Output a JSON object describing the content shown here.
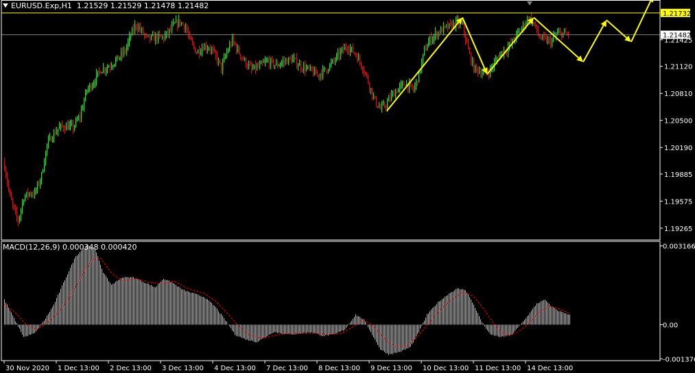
{
  "header": {
    "symbol": "EURUSD.Exp,H1",
    "ohlc": "1.21529 1.21529 1.21478 1.21482"
  },
  "macd_header": {
    "name": "MACD(12,26,9)",
    "values": "0.000348 0.000420"
  },
  "colors": {
    "bull": "#00ff00",
    "bear": "#ff0000",
    "level_line": "#ffff00",
    "arrows": "#ffff00",
    "macd_hist": "#c0c0c0",
    "signal": "#ff0000",
    "axis": "#ffffff",
    "bid_line": "#808080"
  },
  "chart_data": [
    {
      "type": "candlestick",
      "title": "EURUSD.Exp,H1",
      "ylim": [
        1.1913,
        1.2188
      ],
      "y_ticks": [
        "1.21425",
        "1.21120",
        "1.20810",
        "1.20500",
        "1.20190",
        "1.19885",
        "1.19575",
        "1.19265"
      ],
      "x_ticks": [
        "30 Nov 2020",
        "1 Dec 13:00",
        "2 Dec 13:00",
        "3 Dec 13:00",
        "4 Dec 13:00",
        "7 Dec 13:00",
        "8 Dec 13:00",
        "9 Dec 13:00",
        "10 Dec 13:00",
        "11 Dec 13:00",
        "14 Dec 13:00"
      ],
      "horizontal_line": {
        "label": "1.21732",
        "value": 1.21732
      },
      "current_price": {
        "label": "1.21482",
        "value": 1.21482
      },
      "close_anchors": [
        [
          0,
          1.1998
        ],
        [
          4,
          1.1962
        ],
        [
          8,
          1.1942
        ],
        [
          10,
          1.1935
        ],
        [
          14,
          1.1962
        ],
        [
          18,
          1.1967
        ],
        [
          22,
          1.1966
        ],
        [
          27,
          1.1987
        ],
        [
          31,
          1.2022
        ],
        [
          35,
          1.2033
        ],
        [
          40,
          1.2042
        ],
        [
          45,
          1.2043
        ],
        [
          50,
          1.2042
        ],
        [
          55,
          1.2055
        ],
        [
          60,
          1.2085
        ],
        [
          64,
          1.2092
        ],
        [
          70,
          1.2108
        ],
        [
          76,
          1.2112
        ],
        [
          82,
          1.212
        ],
        [
          88,
          1.213
        ],
        [
          92,
          1.2148
        ],
        [
          96,
          1.216
        ],
        [
          100,
          1.2152
        ],
        [
          104,
          1.2143
        ],
        [
          110,
          1.2145
        ],
        [
          116,
          1.2145
        ],
        [
          120,
          1.2152
        ],
        [
          124,
          1.216
        ],
        [
          128,
          1.2163
        ],
        [
          132,
          1.2157
        ],
        [
          135,
          1.2142
        ],
        [
          140,
          1.2128
        ],
        [
          145,
          1.2135
        ],
        [
          150,
          1.2133
        ],
        [
          155,
          1.212
        ],
        [
          158,
          1.211
        ],
        [
          162,
          1.2128
        ],
        [
          166,
          1.2142
        ],
        [
          170,
          1.213
        ],
        [
          175,
          1.2118
        ],
        [
          180,
          1.2108
        ],
        [
          186,
          1.2112
        ],
        [
          192,
          1.2118
        ],
        [
          198,
          1.2113
        ],
        [
          204,
          1.2118
        ],
        [
          210,
          1.212
        ],
        [
          216,
          1.2112
        ],
        [
          222,
          1.2108
        ],
        [
          228,
          1.2102
        ],
        [
          234,
          1.2108
        ],
        [
          240,
          1.2118
        ],
        [
          246,
          1.213
        ],
        [
          250,
          1.2135
        ],
        [
          256,
          1.2126
        ],
        [
          262,
          1.2108
        ],
        [
          266,
          1.209
        ],
        [
          270,
          1.2072
        ],
        [
          274,
          1.2063
        ],
        [
          278,
          1.2068
        ],
        [
          282,
          1.2078
        ],
        [
          286,
          1.2085
        ],
        [
          292,
          1.2093
        ],
        [
          298,
          1.2085
        ],
        [
          302,
          1.2102
        ],
        [
          306,
          1.213
        ],
        [
          310,
          1.2142
        ],
        [
          315,
          1.215
        ],
        [
          320,
          1.2155
        ],
        [
          325,
          1.2158
        ],
        [
          330,
          1.2162
        ],
        [
          334,
          1.2158
        ],
        [
          338,
          1.213
        ],
        [
          342,
          1.211
        ],
        [
          346,
          1.2107
        ],
        [
          350,
          1.2103
        ],
        [
          354,
          1.2108
        ],
        [
          358,
          1.2118
        ],
        [
          362,
          1.2128
        ],
        [
          366,
          1.2132
        ],
        [
          370,
          1.214
        ],
        [
          374,
          1.215
        ],
        [
          378,
          1.2158
        ],
        [
          382,
          1.2168
        ],
        [
          386,
          1.216
        ],
        [
          390,
          1.2145
        ],
        [
          394,
          1.2142
        ],
        [
          398,
          1.214
        ],
        [
          402,
          1.2148
        ],
        [
          406,
          1.215
        ],
        [
          411,
          1.2148
        ]
      ],
      "forecast_arrows": [
        [
          [
            279,
            1.2061
          ],
          [
            334,
            1.2168
          ]
        ],
        [
          [
            334,
            1.2168
          ],
          [
            352,
            1.2103
          ]
        ],
        [
          [
            352,
            1.2103
          ],
          [
            386,
            1.2168
          ]
        ],
        [
          [
            386,
            1.2168
          ],
          [
            422,
            1.2117
          ]
        ],
        [
          [
            422,
            1.2117
          ],
          [
            439,
            1.2165
          ]
        ],
        [
          [
            439,
            1.2165
          ],
          [
            457,
            1.214
          ]
        ],
        [
          [
            457,
            1.214
          ],
          [
            473,
            1.2193
          ]
        ]
      ]
    },
    {
      "type": "macd",
      "title": "MACD(12,26,9)",
      "ylim": [
        -0.00145,
        0.00335
      ],
      "y_ticks": [
        {
          "label": "0.003166",
          "value": 0.003166
        },
        {
          "label": "0.00",
          "value": 0
        },
        {
          "label": "-0.001376",
          "value": -0.001376
        }
      ],
      "macd_anchors": [
        [
          0,
          0.001
        ],
        [
          8,
          0.00015
        ],
        [
          14,
          -0.0005
        ],
        [
          22,
          -0.00035
        ],
        [
          30,
          0.00025
        ],
        [
          36,
          0.0008
        ],
        [
          44,
          0.0018
        ],
        [
          52,
          0.00275
        ],
        [
          60,
          0.0032
        ],
        [
          66,
          0.00305
        ],
        [
          72,
          0.0021
        ],
        [
          78,
          0.0016
        ],
        [
          86,
          0.0019
        ],
        [
          94,
          0.0019
        ],
        [
          102,
          0.0017
        ],
        [
          110,
          0.0015
        ],
        [
          116,
          0.00185
        ],
        [
          122,
          0.0017
        ],
        [
          130,
          0.0014
        ],
        [
          138,
          0.00125
        ],
        [
          146,
          0.0011
        ],
        [
          154,
          0.0007
        ],
        [
          162,
          0.0001
        ],
        [
          168,
          -0.0004
        ],
        [
          176,
          -0.0006
        ],
        [
          184,
          -0.0007
        ],
        [
          190,
          -0.0005
        ],
        [
          196,
          -0.0003
        ],
        [
          202,
          -0.00035
        ],
        [
          208,
          -0.0004
        ],
        [
          216,
          -0.00035
        ],
        [
          224,
          -0.0003
        ],
        [
          232,
          -0.00045
        ],
        [
          240,
          -0.0004
        ],
        [
          248,
          -0.0002
        ],
        [
          256,
          0.0004
        ],
        [
          262,
          0.0002
        ],
        [
          268,
          -0.0004
        ],
        [
          274,
          -0.001
        ],
        [
          280,
          -0.0012
        ],
        [
          288,
          -0.0011
        ],
        [
          296,
          -0.0009
        ],
        [
          302,
          -0.0003
        ],
        [
          308,
          0.0004
        ],
        [
          316,
          0.0009
        ],
        [
          324,
          0.00125
        ],
        [
          330,
          0.00145
        ],
        [
          336,
          0.0014
        ],
        [
          342,
          0.0008
        ],
        [
          348,
          0.0001
        ],
        [
          354,
          -0.0004
        ],
        [
          362,
          -0.0005
        ],
        [
          370,
          -0.0004
        ],
        [
          376,
          0.0
        ],
        [
          382,
          0.0004
        ],
        [
          388,
          0.00085
        ],
        [
          394,
          0.001
        ],
        [
          398,
          0.00075
        ],
        [
          404,
          0.00055
        ],
        [
          412,
          0.0004
        ]
      ],
      "signal_anchors": [
        [
          0,
          0.0008
        ],
        [
          8,
          0.0005
        ],
        [
          16,
          0.0
        ],
        [
          24,
          -0.0002
        ],
        [
          32,
          0.0001
        ],
        [
          40,
          0.0005
        ],
        [
          48,
          0.0011
        ],
        [
          56,
          0.0019
        ],
        [
          64,
          0.0026
        ],
        [
          70,
          0.0027
        ],
        [
          78,
          0.0021
        ],
        [
          86,
          0.00175
        ],
        [
          96,
          0.00185
        ],
        [
          106,
          0.0017
        ],
        [
          116,
          0.00165
        ],
        [
          124,
          0.00175
        ],
        [
          134,
          0.00145
        ],
        [
          146,
          0.00125
        ],
        [
          154,
          0.00095
        ],
        [
          162,
          0.0005
        ],
        [
          170,
          0.0
        ],
        [
          178,
          -0.0004
        ],
        [
          188,
          -0.00055
        ],
        [
          196,
          -0.00045
        ],
        [
          206,
          -0.00035
        ],
        [
          216,
          -0.00035
        ],
        [
          226,
          -0.00035
        ],
        [
          236,
          -0.0004
        ],
        [
          246,
          -0.00035
        ],
        [
          254,
          -0.0001
        ],
        [
          262,
          0.0002
        ],
        [
          270,
          -0.0001
        ],
        [
          278,
          -0.0006
        ],
        [
          286,
          -0.0009
        ],
        [
          294,
          -0.00085
        ],
        [
          302,
          -0.00045
        ],
        [
          310,
          0.0001
        ],
        [
          318,
          0.0006
        ],
        [
          326,
          0.001
        ],
        [
          334,
          0.0013
        ],
        [
          342,
          0.00115
        ],
        [
          350,
          0.0006
        ],
        [
          358,
          -5e-05
        ],
        [
          366,
          -0.00045
        ],
        [
          374,
          -0.0003
        ],
        [
          382,
          0.0
        ],
        [
          390,
          0.0005
        ],
        [
          398,
          0.00075
        ],
        [
          406,
          0.0006
        ],
        [
          412,
          0.00045
        ]
      ]
    }
  ]
}
